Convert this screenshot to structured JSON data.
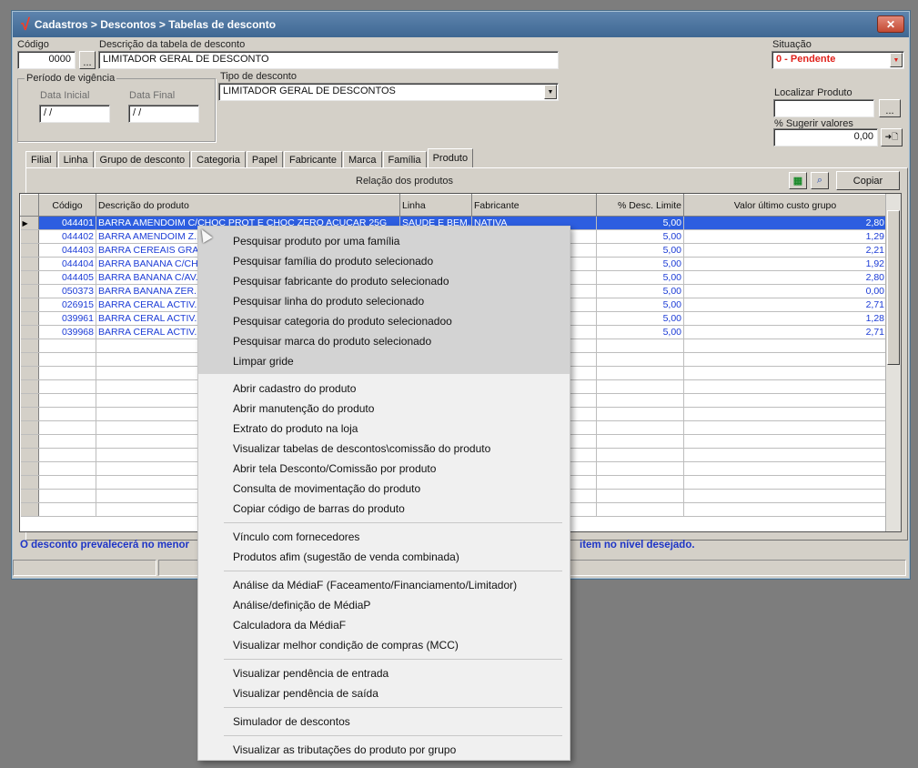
{
  "window": {
    "title": "Cadastros > Descontos > Tabelas de desconto",
    "close_glyph": "✕"
  },
  "form": {
    "codigo_label": "Código",
    "codigo_value": "0000",
    "codigo_btn": "...",
    "descricao_label": "Descrição da tabela de desconto",
    "descricao_value": "LIMITADOR GERAL DE DESCONTO",
    "situacao_label": "Situação",
    "situacao_value": "0 - Pendente",
    "periodo_label": "Período de vigência",
    "data_inicial_label": "Data Inicial",
    "data_inicial_value": " / /",
    "data_final_label": "Data Final",
    "data_final_value": " / /",
    "tipo_label": "Tipo de desconto",
    "tipo_value": "LIMITADOR GERAL DE DESCONTOS",
    "localizar_label": "Localizar Produto",
    "localizar_btn": "...",
    "sugerir_label": "% Sugerir valores",
    "sugerir_value": "0,00",
    "sugerir_btn": "➜🗋"
  },
  "tabs": [
    "Filial",
    "Linha",
    "Grupo de desconto",
    "Categoria",
    "Papel",
    "Fabricante",
    "Marca",
    "Família",
    "Produto"
  ],
  "active_tab": "Produto",
  "panel": {
    "caption": "Relação dos produtos",
    "copy_label": "Copiar"
  },
  "grid": {
    "columns": [
      "Código",
      "Descrição do produto",
      "Linha",
      "Fabricante",
      "% Desc. Limite",
      "Valor último custo grupo"
    ],
    "rows": [
      {
        "codigo": "044401",
        "descricao": "BARRA AMENDOIM C/CHOC PROT E CHOC ZERO ACUCAR 25G",
        "linha": "SAUDE E BEM...",
        "fabricante": "NATIVA",
        "desc": "5,00",
        "valor": "2,80"
      },
      {
        "codigo": "044402",
        "descricao": "BARRA AMENDOIM Z...",
        "linha": "",
        "fabricante": "",
        "desc": "5,00",
        "valor": "1,29"
      },
      {
        "codigo": "044403",
        "descricao": "BARRA CEREAIS GRA...",
        "linha": "",
        "fabricante": "",
        "desc": "5,00",
        "valor": "2,21"
      },
      {
        "codigo": "044404",
        "descricao": "BARRA BANANA C/CH...",
        "linha": "",
        "fabricante": "",
        "desc": "5,00",
        "valor": "1,92"
      },
      {
        "codigo": "044405",
        "descricao": "BARRA BANANA C/AV...",
        "linha": "",
        "fabricante": "",
        "desc": "5,00",
        "valor": "2,80"
      },
      {
        "codigo": "050373",
        "descricao": "BARRA BANANA ZER...",
        "linha": "",
        "fabricante": "",
        "desc": "5,00",
        "valor": "0,00"
      },
      {
        "codigo": "026915",
        "descricao": "BARRA CERAL ACTIV...",
        "linha": "",
        "fabricante": "",
        "desc": "5,00",
        "valor": "2,71"
      },
      {
        "codigo": "039961",
        "descricao": "BARRA CERAL ACTIV...",
        "linha": "",
        "fabricante": "",
        "desc": "5,00",
        "valor": "1,28"
      },
      {
        "codigo": "039968",
        "descricao": "BARRA CERAL ACTIV...",
        "linha": "",
        "fabricante": "",
        "desc": "5,00",
        "valor": "2,71"
      }
    ]
  },
  "footer": {
    "msg_left": "O desconto prevalecerá no menor",
    "msg_right": "item no nível desejado."
  },
  "context_menu": {
    "items": [
      "Pesquisar produto por uma família",
      "Pesquisar família do produto selecionado",
      "Pesquisar fabricante do produto selecionado",
      "Pesquisar linha do produto selecionado",
      "Pesquisar categoria do produto selecionadoo",
      "Pesquisar marca do produto selecionado",
      "Limpar gride",
      "Abrir cadastro do produto",
      "Abrir manutenção do produto",
      "Extrato do produto na loja",
      "Visualizar tabelas de descontos\\comissão do produto",
      "Abrir tela Desconto/Comissão por produto",
      "Consulta de movimentação do produto",
      "Copiar código de barras do produto",
      "Vínculo com fornecedores",
      "Produtos afim (sugestão de venda combinada)",
      "Análise da MédiaF (Faceamento/Financiamento/Limitador)",
      "Análise/definição de MédiaP",
      "Calculadora da MédiaF",
      "Visualizar melhor condição de compras (MCC)",
      "Visualizar pendência de entrada",
      "Visualizar pendência de saída",
      "Simulador de descontos",
      "Visualizar as tributações do produto por grupo"
    ]
  }
}
